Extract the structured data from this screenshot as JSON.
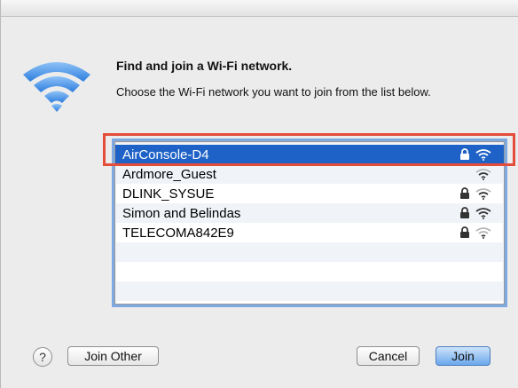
{
  "dialog": {
    "title": "Find and join a Wi-Fi network.",
    "subtitle": "Choose the Wi-Fi network you want to join from the list below."
  },
  "networks": [
    {
      "name": "AirConsole-D4",
      "secured": true,
      "selected": true
    },
    {
      "name": "Ardmore_Guest",
      "secured": false,
      "selected": false
    },
    {
      "name": "DLINK_SYSUE",
      "secured": true,
      "selected": false
    },
    {
      "name": "Simon and Belindas",
      "secured": true,
      "selected": false
    },
    {
      "name": "TELECOMA842E9",
      "secured": true,
      "selected": false
    }
  ],
  "buttons": {
    "help": "?",
    "join_other": "Join Other",
    "cancel": "Cancel",
    "join": "Join"
  },
  "colors": {
    "selection": "#1e62c7",
    "highlight_box": "#e34d3a",
    "wifi_blue": "#3f8ee6"
  },
  "icons": {
    "header": "wifi-icon",
    "row_lock": "lock-icon",
    "row_signal": "wifi-signal-icon",
    "help": "help-icon"
  }
}
